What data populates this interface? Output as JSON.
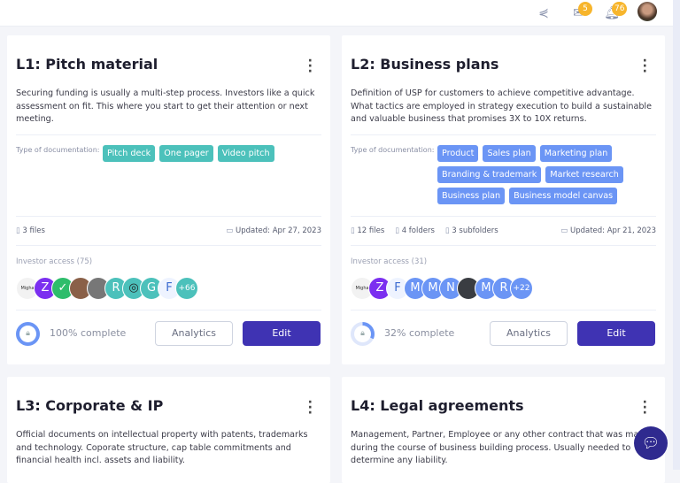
{
  "topbar": {
    "mail_badge": "5",
    "bell_badge": "76"
  },
  "colors": {
    "tag_teal": "#4cc1bb",
    "tag_blue": "#6b95f5",
    "edit": "#3f33b3",
    "badge": "#f7b52c"
  },
  "cards": [
    {
      "title": "L1: Pitch material",
      "description": "Securing funding is usually a multi-step process. Investors like a quick assessment on fit. This where you start to get their attention or next meeting.",
      "doc_label": "Type of documentation:",
      "tag_color": "#4cc1bb",
      "tags": [
        "Pitch deck",
        "One pager",
        "Video pitch"
      ],
      "meta": [
        "3 files"
      ],
      "updated": "Updated: Apr 27, 2023",
      "investor_label": "Investor access (75)",
      "avatars": [
        {
          "t": "Migha",
          "c": "#f2f2f2",
          "fg": "#333"
        },
        {
          "t": "Z",
          "c": "#7b2ff0"
        },
        {
          "t": "✓",
          "c": "#2ebd6b"
        },
        {
          "t": "",
          "c": "#8a6048"
        },
        {
          "t": "",
          "c": "#777"
        },
        {
          "t": "R",
          "c": "#4cc1bb"
        },
        {
          "t": "◎",
          "c": "#4cc1bb",
          "fg": "#222"
        },
        {
          "t": "G",
          "c": "#4cc1bb"
        },
        {
          "t": "F",
          "c": "#eef3ff",
          "fg": "#3a6ad0"
        },
        {
          "t": "+66",
          "c": "#4cc1bb"
        }
      ],
      "progress": 100,
      "progress_text": "100% complete",
      "analytics": "Analytics",
      "edit": "Edit"
    },
    {
      "title": "L2: Business plans",
      "description": "Definition of USP for customers to achieve competitive advantage. What tactics are employed in strategy execution to build a sustainable and valuable business that promises 3X to 10X returns.",
      "doc_label": "Type of documentation:",
      "tag_color": "#6b95f5",
      "tags": [
        "Product",
        "Sales plan",
        "Marketing plan",
        "Branding & trademark",
        "Market research",
        "Business plan",
        "Business model canvas"
      ],
      "meta": [
        "12 files",
        "4 folders",
        "3 subfolders"
      ],
      "updated": "Updated: Apr 21, 2023",
      "investor_label": "Investor access (31)",
      "avatars": [
        {
          "t": "Migha",
          "c": "#f2f2f2",
          "fg": "#333"
        },
        {
          "t": "Z",
          "c": "#7b2ff0"
        },
        {
          "t": "F",
          "c": "#eef3ff",
          "fg": "#3a6ad0"
        },
        {
          "t": "M",
          "c": "#6b95f5"
        },
        {
          "t": "M",
          "c": "#6b95f5"
        },
        {
          "t": "N",
          "c": "#6b95f5"
        },
        {
          "t": "",
          "c": "#3a3d42"
        },
        {
          "t": "M",
          "c": "#6b95f5"
        },
        {
          "t": "R",
          "c": "#6b95f5"
        },
        {
          "t": "+22",
          "c": "#6b95f5"
        }
      ],
      "progress": 32,
      "progress_text": "32% complete",
      "analytics": "Analytics",
      "edit": "Edit"
    },
    {
      "title": "L3: Corporate & IP",
      "description": "Official documents on intellectual property with patents, trademarks and technology. Coporate structure, cap table commitments and financial health incl. assets and liability."
    },
    {
      "title": "L4: Legal agreements",
      "description": "Management, Partner, Employee or any other contract that was made during the course of business building process. Usually needed to determine any liability."
    }
  ]
}
